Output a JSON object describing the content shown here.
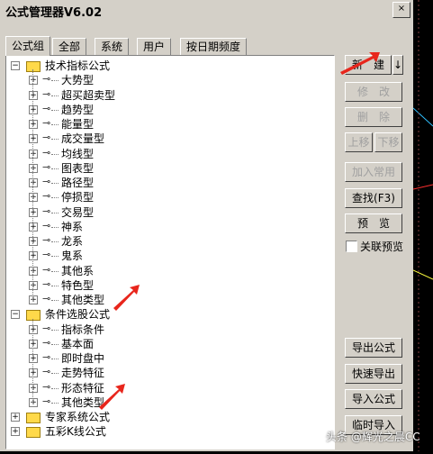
{
  "window": {
    "title": "公式管理器V6.02",
    "close_label": "×"
  },
  "tabs": [
    {
      "label": "公式组"
    },
    {
      "label": "全部"
    },
    {
      "label": "系统"
    },
    {
      "label": "用户"
    },
    {
      "label": "按日期频度"
    }
  ],
  "tree": {
    "groups": [
      {
        "label": "技术指标公式",
        "expanded": true,
        "children": [
          "大势型",
          "超买超卖型",
          "趋势型",
          "能量型",
          "成交量型",
          "均线型",
          "图表型",
          "路径型",
          "停损型",
          "交易型",
          "神系",
          "龙系",
          "鬼系",
          "其他系",
          "特色型",
          "其他类型"
        ]
      },
      {
        "label": "条件选股公式",
        "expanded": true,
        "children": [
          "指标条件",
          "基本面",
          "即时盘中",
          "走势特征",
          "形态特征",
          "其他类型"
        ]
      },
      {
        "label": "专家系统公式",
        "expanded": false,
        "children": []
      },
      {
        "label": "五彩K线公式",
        "expanded": false,
        "children": []
      }
    ]
  },
  "buttons": {
    "new": "新　建",
    "new_dropdown": "↓",
    "modify": "修　改",
    "delete": "删　除",
    "move_up": "上移",
    "move_down": "下移",
    "add_common": "加入常用",
    "find": "查找(F3)",
    "preview": "预　览",
    "linked_preview": "关联预览",
    "export": "导出公式",
    "quick_export": "快速导出",
    "import": "导入公式",
    "temp_import": "临时导入"
  },
  "watermark": "头条 @辉光之晨CC",
  "colors": {
    "annotation_arrow": "#e8261c",
    "folder": "#ffd94a",
    "disabled_text": "#a0a0a0"
  }
}
